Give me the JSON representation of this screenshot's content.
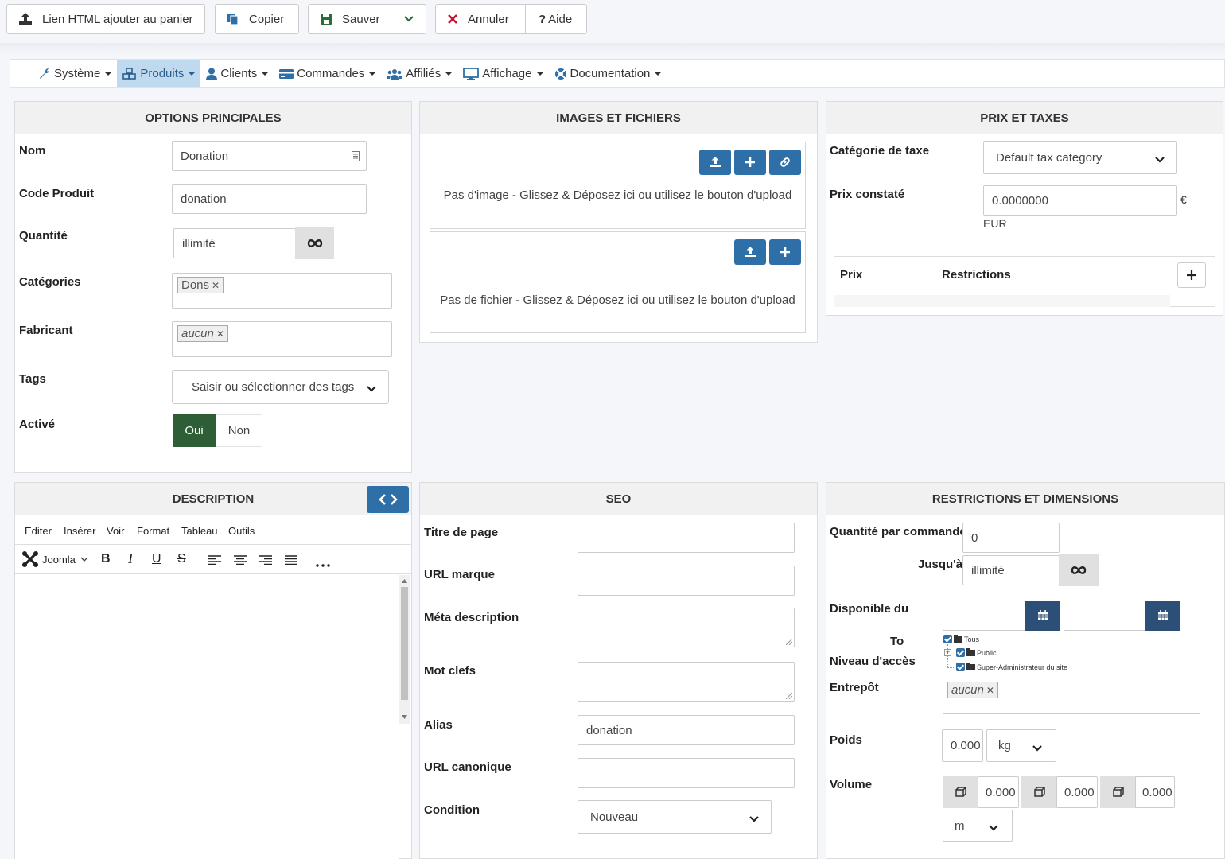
{
  "toolbar": {
    "html_link": "Lien HTML ajouter au panier",
    "copy": "Copier",
    "save": "Sauver",
    "cancel": "Annuler",
    "help": "Aide"
  },
  "menu": {
    "items": [
      {
        "label": "Système",
        "icon": "wrench-icon"
      },
      {
        "label": "Produits",
        "icon": "cubes-icon"
      },
      {
        "label": "Clients",
        "icon": "user-icon"
      },
      {
        "label": "Commandes",
        "icon": "credit-card-icon"
      },
      {
        "label": "Affiliés",
        "icon": "users-icon"
      },
      {
        "label": "Affichage",
        "icon": "desktop-icon"
      },
      {
        "label": "Documentation",
        "icon": "life-ring-icon"
      }
    ]
  },
  "main_options": {
    "title": "OPTIONS PRINCIPALES",
    "name_label": "Nom",
    "name_value": "Donation",
    "code_label": "Code Produit",
    "code_value": "donation",
    "qty_label": "Quantité",
    "qty_value": "illimité",
    "categories_label": "Catégories",
    "category_chip": "Dons",
    "manufacturer_label": "Fabricant",
    "manufacturer_chip": "aucun",
    "tags_label": "Tags",
    "tags_placeholder": "Saisir ou sélectionner des tags",
    "active_label": "Activé",
    "yes": "Oui",
    "no": "Non"
  },
  "images": {
    "title": "IMAGES ET FICHIERS",
    "no_image": "Pas d'image - Glissez & Déposez ici ou utilisez le bouton d'upload",
    "no_file": "Pas de fichier - Glissez & Déposez ici ou utilisez le bouton d'upload"
  },
  "prices": {
    "title": "PRIX ET TAXES",
    "tax_label": "Catégorie de taxe",
    "tax_value": "Default tax category",
    "price_label": "Prix constaté",
    "price_value": "0.0000000",
    "currency_symbol": "€",
    "currency": "EUR",
    "col_price": "Prix",
    "col_restrictions": "Restrictions"
  },
  "description": {
    "title": "DESCRIPTION",
    "menu": [
      "Editer",
      "Insérer",
      "Voir",
      "Format",
      "Tableau",
      "Outils"
    ],
    "joomla": "Joomla"
  },
  "seo": {
    "title": "SEO",
    "page_title_label": "Titre de page",
    "url_label": "URL marque",
    "meta_label": "Méta description",
    "keywords_label": "Mot clefs",
    "alias_label": "Alias",
    "alias_value": "donation",
    "canonical_label": "URL canonique",
    "condition_label": "Condition",
    "condition_value": "Nouveau"
  },
  "restrictions": {
    "title": "RESTRICTIONS ET DIMENSIONS",
    "qty_per_order_label": "Quantité par commande",
    "qty_per_order_value": "0",
    "until_label": "Jusqu'à",
    "until_value": "illimité",
    "available_label": "Disponible du",
    "to_label": "To",
    "access_label": "Niveau d'accès",
    "tree": [
      "Tous",
      "Public",
      "Super-Administrateur du site"
    ],
    "warehouse_label": "Entrepôt",
    "warehouse_chip": "aucun",
    "weight_label": "Poids",
    "weight_value": "0.000",
    "weight_unit": "kg",
    "volume_label": "Volume",
    "volume_values": [
      "0.000",
      "0.000",
      "0.000"
    ],
    "volume_unit": "m"
  }
}
